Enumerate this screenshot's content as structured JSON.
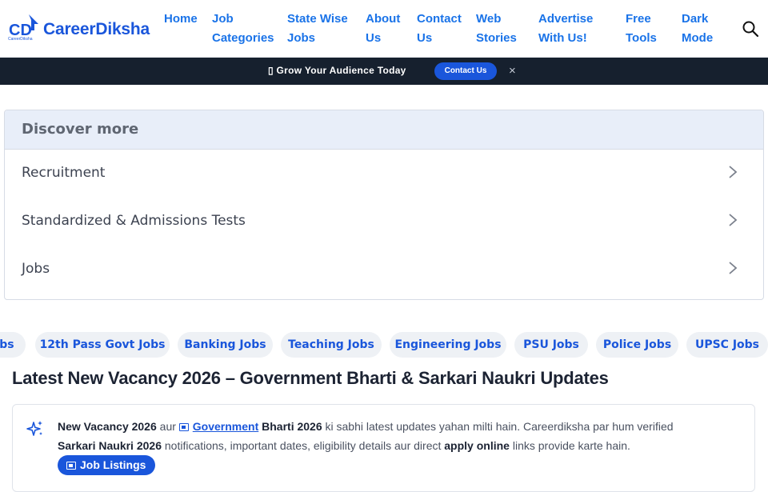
{
  "header": {
    "logo_text": "CareerDiksha",
    "logo_mark": "CD",
    "logo_sub": "CareerDiksha",
    "nav": [
      {
        "label_line1": "Home",
        "label_line2": ""
      },
      {
        "label_line1": "Job",
        "label_line2": "Categories"
      },
      {
        "label_line1": "State Wise",
        "label_line2": "Jobs"
      },
      {
        "label_line1": "About",
        "label_line2": "Us"
      },
      {
        "label_line1": "Contact",
        "label_line2": "Us"
      },
      {
        "label_line1": "Web",
        "label_line2": "Stories"
      },
      {
        "label_line1": "Advertise",
        "label_line2": "With Us!"
      },
      {
        "label_line1": "Free",
        "label_line2": "Tools"
      },
      {
        "label_line1": "Dark",
        "label_line2": "Mode"
      }
    ],
    "search_icon": "search-icon"
  },
  "promo": {
    "text": "▯ Grow Your Audience Today",
    "button": "Contact Us",
    "close": "×"
  },
  "discover": {
    "title": "Discover more",
    "items": [
      {
        "label": "Recruitment"
      },
      {
        "label": "Standardized & Admissions Tests"
      },
      {
        "label": "Jobs"
      }
    ]
  },
  "chips": [
    "Jobs",
    "12th Pass Govt Jobs",
    "Banking Jobs",
    "Teaching Jobs",
    "Engineering Jobs",
    "PSU Jobs",
    "Police Jobs",
    "UPSC Jobs"
  ],
  "main": {
    "title": "Latest New Vacancy 2026 – Government Bharti & Sarkari Naukri Updates",
    "intro": {
      "bold1": "New Vacancy 2026",
      "text1": " aur ",
      "link": "Government",
      "bold2": " Bharti 2026",
      "text2": " ki sabhi latest updates yahan milti hain. Careerdiksha par hum verified",
      "bold3": "Sarkari Naukri 2026",
      "text3": " notifications, important dates, eligibility details aur direct ",
      "bold4": "apply online",
      "text4": " links provide karte hain."
    },
    "button": "Job Listings"
  },
  "colors": {
    "brand": "#1a56db",
    "promo_bg": "#16202e",
    "discover_head": "#e8eef9"
  }
}
